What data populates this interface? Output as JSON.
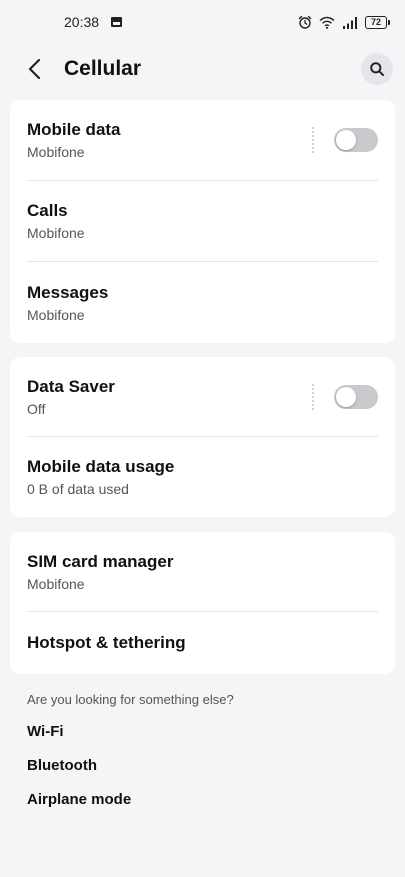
{
  "status_bar": {
    "time": "20:38",
    "battery": "72",
    "icons": [
      "image-notification-icon",
      "alarm-icon",
      "wifi-icon",
      "signal-icon",
      "battery-icon"
    ]
  },
  "header": {
    "title": "Cellular",
    "back_icon": "chevron-left-icon",
    "search_icon": "search-icon"
  },
  "sections": [
    {
      "rows": [
        {
          "title": "Mobile data",
          "subtitle": "Mobifone",
          "toggle": false
        },
        {
          "title": "Calls",
          "subtitle": "Mobifone"
        },
        {
          "title": "Messages",
          "subtitle": "Mobifone"
        }
      ]
    },
    {
      "rows": [
        {
          "title": "Data Saver",
          "subtitle": "Off",
          "toggle": false
        },
        {
          "title": "Mobile data usage",
          "subtitle": "0 B of data used"
        }
      ]
    },
    {
      "rows": [
        {
          "title": "SIM card manager",
          "subtitle": "Mobifone"
        },
        {
          "title": "Hotspot & tethering"
        }
      ]
    }
  ],
  "suggestions": {
    "label": "Are you looking for something else?",
    "links": [
      "Wi-Fi",
      "Bluetooth",
      "Airplane mode"
    ]
  },
  "colors": {
    "background": "#f5f5f7",
    "card": "#ffffff",
    "toggle_off": "#c9c9cd"
  }
}
